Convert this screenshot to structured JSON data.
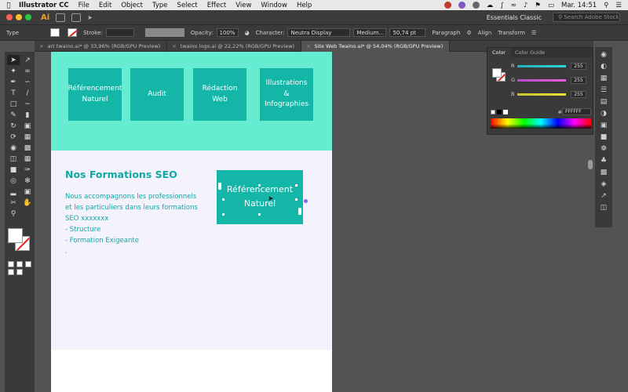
{
  "menubar": {
    "app_name": "Illustrator CC",
    "items": [
      "File",
      "Edit",
      "Object",
      "Type",
      "Select",
      "Effect",
      "View",
      "Window",
      "Help"
    ],
    "clock": "Mar. 14:51"
  },
  "appbar": {
    "logo": "Ai",
    "workspace": "Essentials Classic",
    "stock_placeholder": "Search Adobe Stock"
  },
  "controlbar": {
    "selection_type": "Type",
    "stroke_label": "Stroke:",
    "opacity_label": "Opacity:",
    "opacity_value": "100%",
    "character_label": "Character:",
    "font_family": "Neutra Display",
    "font_style": "Medium...",
    "font_size": "50,74 pt",
    "paragraph_label": "Paragraph",
    "align_label": "Align",
    "transform_label": "Transform"
  },
  "tabs": [
    {
      "label": "art twaino.ai* @ 33,96% (RGB/GPU Preview)",
      "active": false
    },
    {
      "label": "twaino logo.ai @ 22,22% (RGB/GPU Preview)",
      "active": false
    },
    {
      "label": "Site Web Twaino.ai* @ 54,04% (RGB/GPU Preview)",
      "active": true
    }
  ],
  "artboard": {
    "cards": [
      "Référencement Naturel",
      "Audit",
      "Rédaction Web",
      "Illustrations & Infographies"
    ],
    "section_title": "Nos Formations SEO",
    "paragraph_lines": [
      "Nous accompagnons les professionnels",
      "et les particuliers dans leurs formations",
      "SEO xxxxxxx",
      "- Structure",
      "- Formation Exigeante",
      "."
    ],
    "selected_box_text": "Référencement Naturel"
  },
  "color_panel": {
    "tab_color": "Color",
    "tab_guide": "Color Guide",
    "channels": [
      {
        "letter": "R",
        "value": "255",
        "color": "#2fd3d6"
      },
      {
        "letter": "G",
        "value": "255",
        "color": "#e85dd8"
      },
      {
        "letter": "B",
        "value": "255",
        "color": "#e9e33a"
      }
    ],
    "hex_label": "#",
    "hex_value": "FFFFFF"
  },
  "colors": {
    "hero_bg": "#66ecd0",
    "card_bg": "#14b7a7",
    "text_teal": "#10a8a4",
    "body_bg": "#f4f3fd",
    "canvas_bg": "#535353"
  }
}
